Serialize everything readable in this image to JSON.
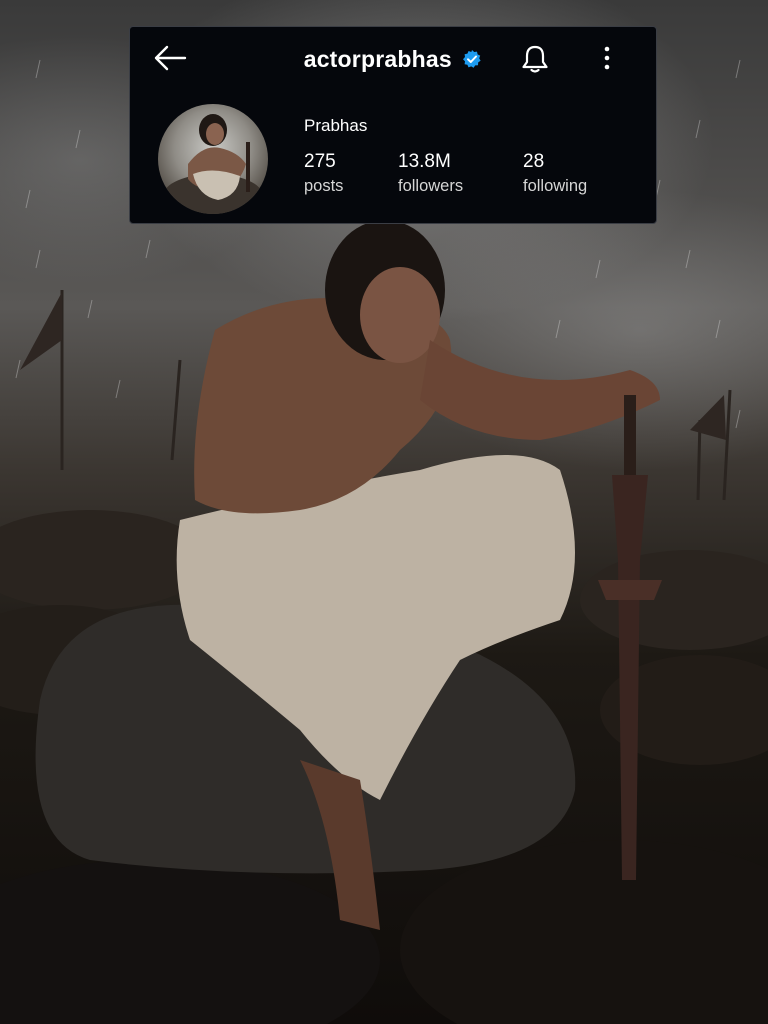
{
  "profile": {
    "username": "actorprabhas",
    "display_name": "Prabhas",
    "verified": true,
    "verified_icon": "verified-badge-icon",
    "accent_color": "#1d9bf0"
  },
  "stats": {
    "posts": {
      "value": "275",
      "label": "posts"
    },
    "followers": {
      "value": "13.8M",
      "label": "followers"
    },
    "following": {
      "value": "28",
      "label": "following"
    }
  },
  "header_icons": {
    "back": "arrow-left-icon",
    "notifications": "bell-icon",
    "more": "more-vertical-icon"
  },
  "background": {
    "description_icon": "warrior-photo"
  }
}
